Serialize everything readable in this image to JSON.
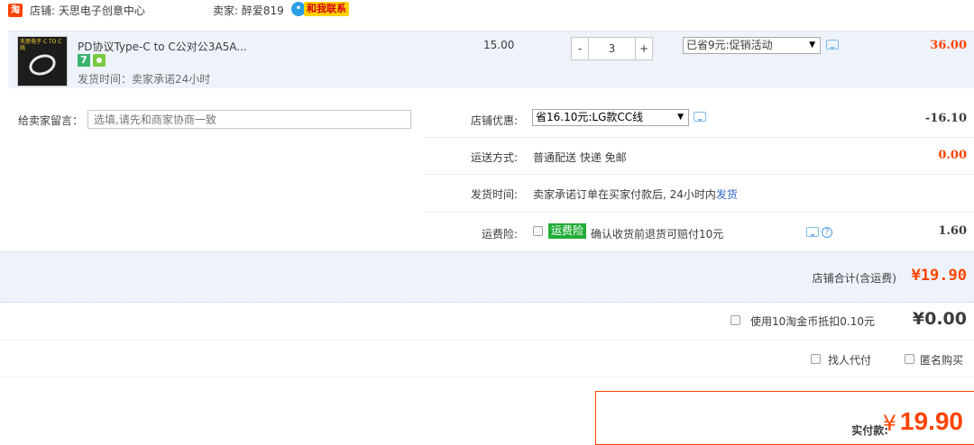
{
  "shop": {
    "logo_glyph": "淘",
    "name": "店铺: 天思电子创意中心",
    "seller": "卖家: 醉爱819",
    "contact_label": "和我联系"
  },
  "item": {
    "image_caption": "天思电子 C TO C线",
    "title": "PD协议Type-C to C公对公3A5A...",
    "badge_7": "7",
    "ship_note": "发货时间：卖家承诺24小时",
    "unit_price": "15.00",
    "qty_minus": "-",
    "qty_value": "3",
    "qty_plus": "+",
    "promo_selected": "已省9元:促销活动",
    "line_total": "36.00"
  },
  "message": {
    "label": "给卖家留言：",
    "placeholder": "选填,请先和商家协商一致"
  },
  "options": {
    "coupon_label": "店铺优惠:",
    "coupon_selected": "省16.10元:LG款CC线",
    "coupon_amount": "-16.10",
    "delivery_label": "运送方式:",
    "delivery_value": "普通配送 快递 免邮",
    "delivery_amount": "0.00",
    "ship_time_label": "发货时间:",
    "ship_time_value": "卖家承诺订单在买家付款后, 24小时内",
    "ship_time_link": "发货",
    "insurance_label": "运费险:",
    "insurance_badge": "运费险",
    "insurance_text": "确认收货前退货可赔付10元",
    "insurance_amount": "1.60"
  },
  "subtotal": {
    "label": "店铺合计(含运费)",
    "value": "¥19.90"
  },
  "coins": {
    "label": "使用10淘金币抵扣0.10元",
    "value": "¥0.00"
  },
  "extras": {
    "proxy_pay": "找人代付",
    "anonymous": "匿名购买"
  },
  "payment": {
    "label": "实付款:",
    "currency": "¥",
    "value": "19.90"
  },
  "colors": {
    "accent": "#ff4400",
    "band": "#eef3fb",
    "link": "#3366cc",
    "insurance": "#23ac38"
  }
}
